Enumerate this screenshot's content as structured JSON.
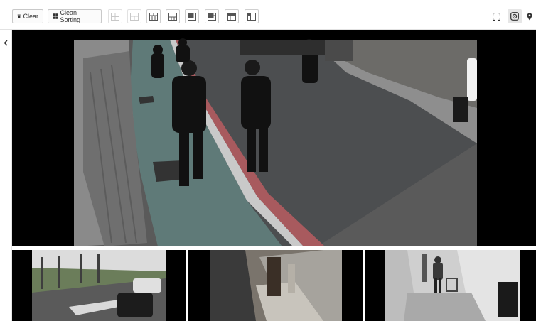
{
  "toolbar": {
    "clear_label": "Clear",
    "clean_sorting_label": "Clean Sorting",
    "layout_buttons": [
      {
        "name": "layout-1x2-h-icon",
        "enabled": false
      },
      {
        "name": "layout-2x2-icon",
        "enabled": false
      },
      {
        "name": "layout-1-top-2-bottom-icon",
        "enabled": true
      },
      {
        "name": "layout-1-top-3-bottom-icon",
        "enabled": true
      },
      {
        "name": "layout-1-left-3-right-icon",
        "enabled": true
      },
      {
        "name": "layout-1-big-5-small-icon",
        "enabled": true
      },
      {
        "name": "layout-2-top-icon",
        "enabled": true
      },
      {
        "name": "layout-corner-icon",
        "enabled": true
      }
    ],
    "right_buttons": [
      "fullscreen-icon",
      "snapshot-target-icon",
      "map-pin-icon"
    ]
  },
  "sidebar": {
    "toggle_icon": "chevron-left-icon"
  },
  "colors": {
    "toolbar_border": "#c9c9c9",
    "video_background": "#000000",
    "active_button": "#e6e6e6"
  }
}
